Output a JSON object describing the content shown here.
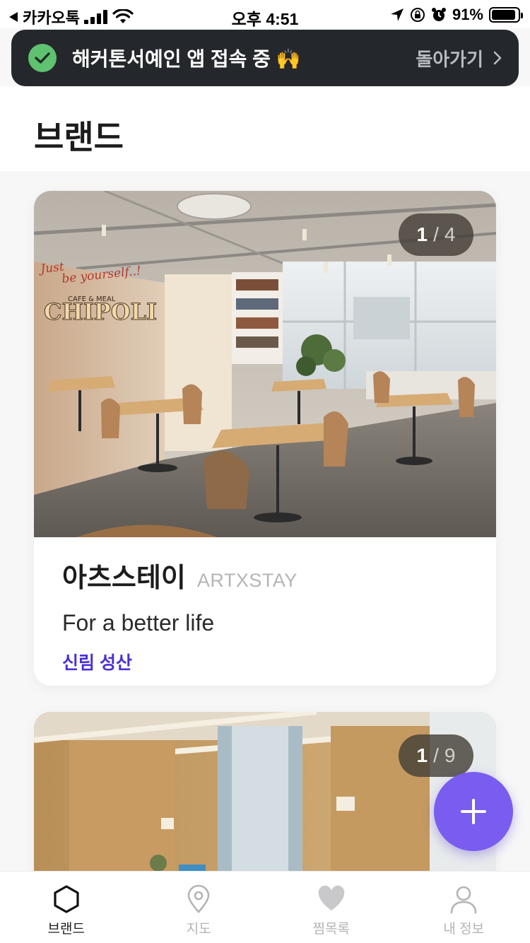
{
  "status_bar": {
    "back_app": "카카오톡",
    "time": "오후 4:51",
    "battery_percent": "91%",
    "battery_level": 0.91
  },
  "banner": {
    "message": "해커톤서예인 앱 접속 중 🙌",
    "back_label": "돌아가기"
  },
  "page": {
    "title": "브랜드"
  },
  "cards": [
    {
      "counter_current": "1",
      "counter_separator": "/",
      "counter_total": "4",
      "name": "아츠스테이",
      "name_en": "ARTXSTAY",
      "slogan": "For a better life",
      "location": "신림 성산"
    },
    {
      "counter_current": "1",
      "counter_separator": "/",
      "counter_total": "9"
    }
  ],
  "photo_signage": {
    "line1": "Just be yourself..!",
    "logo": "CHIPOLI",
    "sub": "CAFE & MEAL"
  },
  "nav": {
    "items": [
      {
        "label": "브랜드",
        "icon": "hexagon-icon",
        "active": true
      },
      {
        "label": "지도",
        "icon": "map-pin-icon",
        "active": false
      },
      {
        "label": "찜목록",
        "icon": "heart-icon",
        "active": false
      },
      {
        "label": "내 정보",
        "icon": "user-icon",
        "active": false
      }
    ]
  },
  "colors": {
    "accent": "#7a5cf0",
    "location": "#4b2fd6",
    "banner_bg": "#24272b",
    "check": "#5ec270"
  }
}
